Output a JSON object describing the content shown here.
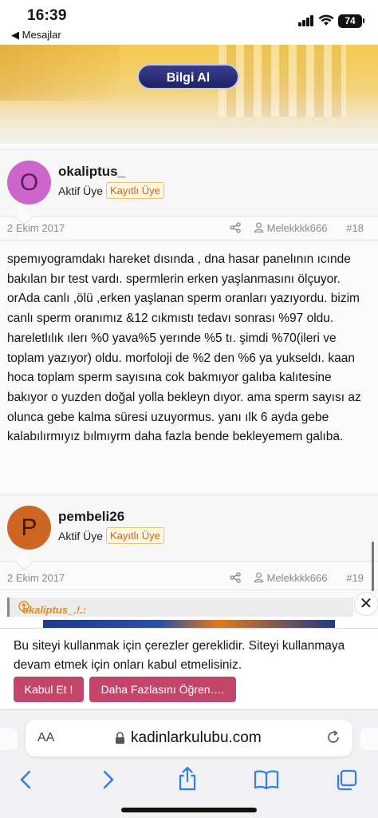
{
  "status_bar": {
    "time": "16:39",
    "back_app": "◀ Mesajlar",
    "battery": "74"
  },
  "banner": {
    "button_label": "Bilgi Al"
  },
  "posts": [
    {
      "avatar_letter": "O",
      "username": "okaliptus_",
      "user_title": "Aktif Üye",
      "badge": "Kayıtlı Üye",
      "date": "2 Ekim 2017",
      "author_ref": "Melekkkk666",
      "number": "#18",
      "body": "spemıyogramdakı hareket dısında , dna hasar panelının ıcınde bakılan bır test vardı. spermlerin erken yaşlanmasını ölçuyor. orAda canlı ,ölü ,erken yaşlanan sperm oranları yazıyordu. bizim canlı sperm oranımız &12 cıkmıstı tedavı sonrası %97 oldu. hareletlılık ılerı %0 yava%5 yerınde %5 tı. şimdi %70(ileri ve toplam yazıyor) oldu. morfoloji de %2 den %6 ya yukseldı. kaan hoca toplam sperm sayısına cok bakmıyor galıba kalıtesine bakıyor o yuzden doğal yolla bekleyn dıyor. ama sperm sayısı az olunca gebe kalma süresi uzuyormus. yanı ılk 6 ayda gebe kalabılırmıyız bılmıyrm daha fazla bende bekleyemem galıba."
    },
    {
      "avatar_letter": "P",
      "username": "pembeli26",
      "user_title": "Aktif Üye",
      "badge": "Kayıtlı Üye",
      "date": "2 Ekim 2017",
      "author_ref": "Melekkkk666",
      "number": "#19",
      "quote_author": "okaliptus_.!.:"
    }
  ],
  "cookie": {
    "text": "Bu siteyi kullanmak için çerezler gereklidir. Siteyi kullanmaya devam etmek için onları kabul etmelisiniz.",
    "accept_label": "Kabul Et !",
    "more_label": "Daha Fazlasını Öğren…."
  },
  "safari": {
    "aa_label": "AA",
    "url": "kadinlarkulubu.com"
  },
  "icons": [
    "signal-icon",
    "wifi-icon",
    "share-icon",
    "user-icon",
    "quote-up-icon",
    "close-icon",
    "lock-icon",
    "reload-icon",
    "back-icon",
    "forward-icon",
    "share-sheet-icon",
    "bookmarks-icon",
    "tabs-icon"
  ]
}
